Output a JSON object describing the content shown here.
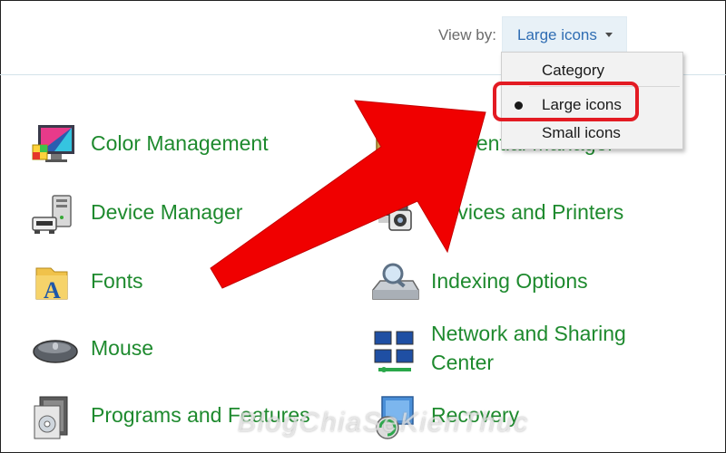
{
  "header": {
    "view_by_label": "View by:",
    "view_by_value": "Large icons"
  },
  "menu": {
    "items": [
      {
        "label": "Category"
      },
      {
        "label": "Large icons",
        "selected": true
      },
      {
        "label": "Small icons"
      }
    ]
  },
  "items": [
    {
      "label": "Color Management",
      "icon": "color-management-icon"
    },
    {
      "label": "Credential Manager",
      "icon": "credential-manager-icon"
    },
    {
      "label": "Device Manager",
      "icon": "device-manager-icon"
    },
    {
      "label": "Devices and Printers",
      "icon": "devices-printers-icon"
    },
    {
      "label": "Fonts",
      "icon": "fonts-icon"
    },
    {
      "label": "Indexing Options",
      "icon": "indexing-options-icon"
    },
    {
      "label": "Mouse",
      "icon": "mouse-icon"
    },
    {
      "label": "Network and Sharing",
      "label2": "Center",
      "icon": "network-sharing-icon"
    },
    {
      "label": "Programs and Features",
      "icon": "programs-features-icon"
    },
    {
      "label": "Recovery",
      "icon": "recovery-icon"
    }
  ],
  "watermark": "BlogChiaSeKienThuc",
  "colors": {
    "link_green": "#1e8a2e",
    "dropdown_blue": "#2f6db3",
    "highlight_red": "#e31b23",
    "arrow_red": "#f00000"
  }
}
